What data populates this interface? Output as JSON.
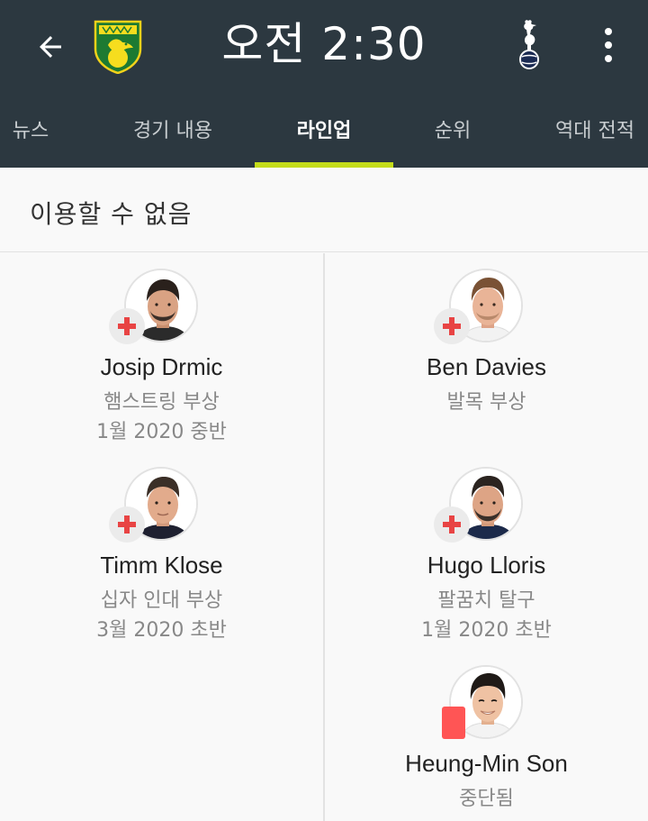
{
  "header": {
    "match_time": "오전 2:30",
    "home_crest": "norwich-canary-crest-icon",
    "away_crest": "tottenham-cockerel-crest-icon",
    "background": "#2c3840"
  },
  "tabs": [
    {
      "label": "뉴스",
      "active": false
    },
    {
      "label": "경기 내용",
      "active": false
    },
    {
      "label": "라인업",
      "active": true
    },
    {
      "label": "순위",
      "active": false
    },
    {
      "label": "역대 전적",
      "active": false
    }
  ],
  "accent": "#c4dc1a",
  "section": {
    "title": "이용할 수 없음"
  },
  "players": {
    "home": [
      {
        "name": "Josip Drmic",
        "status": "햄스트링 부상",
        "return": "1월 2020 중반",
        "badge": "injury-cross-icon"
      },
      {
        "name": "Timm Klose",
        "status": "십자 인대 부상",
        "return": "3월 2020 초반",
        "badge": "injury-cross-icon"
      }
    ],
    "away": [
      {
        "name": "Ben Davies",
        "status": "발목 부상",
        "badge": "injury-cross-icon"
      },
      {
        "name": "Hugo Lloris",
        "status": "팔꿈치 탈구",
        "return": "1월 2020 초반",
        "badge": "injury-cross-icon"
      },
      {
        "name": "Heung-Min Son",
        "status": "중단됨",
        "badge": "red-card-icon"
      }
    ]
  },
  "colors": {
    "injury_cross": "#e84444",
    "red_card": "#ff5555"
  }
}
